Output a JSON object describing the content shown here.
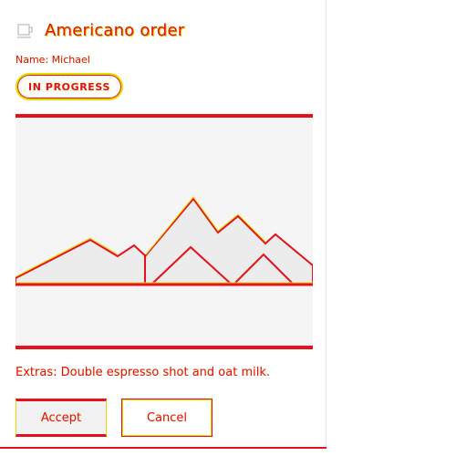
{
  "header": {
    "icon": "coffee-cup-icon",
    "title": "Americano order"
  },
  "customer": {
    "name_line": "Name: Michael"
  },
  "status": {
    "label": "IN PROGRESS"
  },
  "image": {
    "icon": "mountain-image-placeholder"
  },
  "extras": {
    "text": "Extras: Double espresso shot and oat milk."
  },
  "actions": {
    "accept_label": "Accept",
    "cancel_label": "Cancel"
  },
  "colors": {
    "accent": "#e8101a",
    "highlight": "#e6dc00",
    "surface": "#f5f5f5"
  }
}
